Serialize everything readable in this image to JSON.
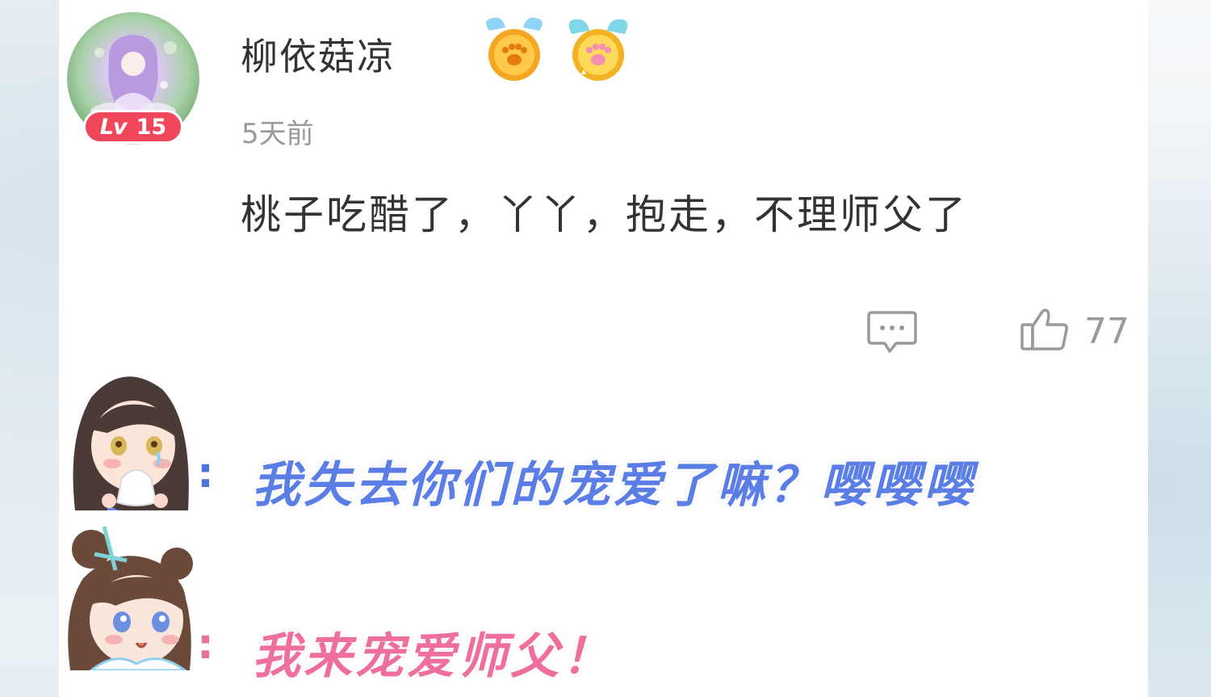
{
  "comment": {
    "user": {
      "name": "柳依菇凉",
      "level_label": "Lv",
      "level_number": "15",
      "avatar_icon": "anime-girl-avatar",
      "medals": [
        "winged-paw-coin-gold-icon",
        "winged-paw-coin-cyan-icon"
      ]
    },
    "timestamp": "5天前",
    "text": "桃子吃醋了，丫丫，抱走，不理师父了",
    "actions": {
      "reply_icon": "comment-bubble-icon",
      "like_icon": "thumbs-up-icon",
      "like_count": "77"
    }
  },
  "reactions": [
    {
      "character_icon": "long-hair-crying-girl",
      "colon": ":",
      "text": "我失去你们的宠爱了嘛？嘤嘤嘤",
      "color": "#5a7ee6"
    },
    {
      "character_icon": "twin-bun-girl",
      "colon": ":",
      "text": "我来宠爱师父！",
      "color": "#ee6f9e"
    }
  ],
  "colors": {
    "level_badge": "#f0475a",
    "text_primary": "#333333",
    "text_secondary": "#9a9a9a"
  }
}
